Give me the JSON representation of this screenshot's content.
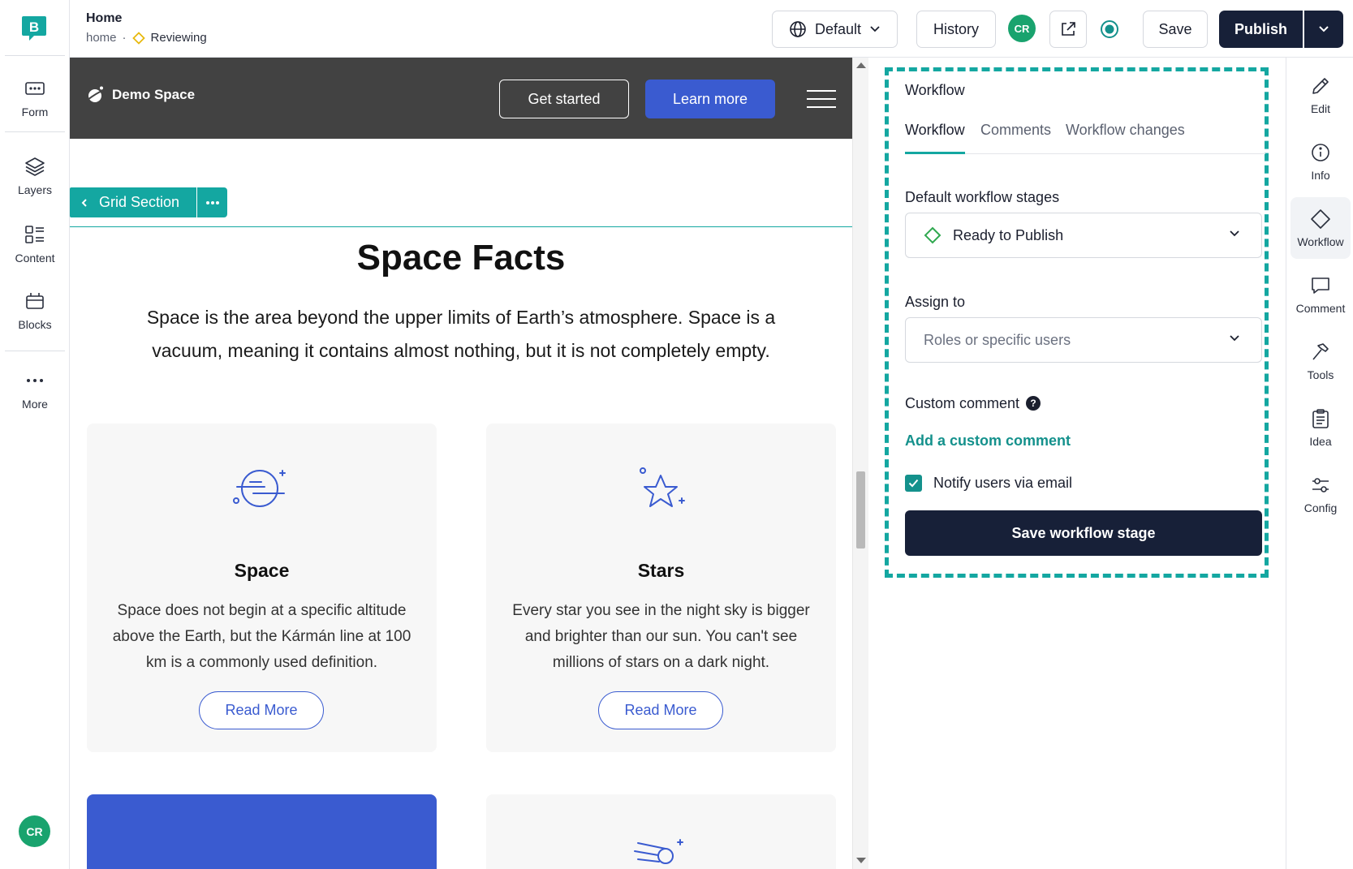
{
  "left_rail": {
    "items": [
      {
        "label": "Form",
        "icon": "form-icon"
      },
      {
        "label": "Layers",
        "icon": "layers-icon"
      },
      {
        "label": "Content",
        "icon": "content-icon"
      },
      {
        "label": "Blocks",
        "icon": "blocks-icon"
      },
      {
        "label": "More",
        "icon": "more-icon"
      }
    ],
    "user_initials": "CR"
  },
  "top_bar": {
    "page_name": "Home",
    "page_path": "home",
    "stage_separator": "·",
    "stage_label": "Reviewing",
    "locale_label": "Default",
    "history_label": "History",
    "user_initials": "CR",
    "save_label": "Save",
    "publish_label": "Publish"
  },
  "canvas": {
    "site_name": "Demo Space",
    "get_started_label": "Get started",
    "learn_more_label": "Learn more",
    "section_label": "Grid Section",
    "title": "Space Facts",
    "intro": "Space is the area beyond the upper limits of Earth’s atmosphere. Space is a vacuum, meaning it contains almost nothing, but it is not completely empty.",
    "cards": [
      {
        "title": "Space",
        "text": "Space does not begin at a specific altitude above the Earth, but the Kármán line at 100 km is a commonly used definition.",
        "button": "Read More"
      },
      {
        "title": "Stars",
        "text": "Every star you see in the night sky is bigger and brighter than our sun. You can't see millions of stars on a dark night.",
        "button": "Read More"
      }
    ]
  },
  "panel": {
    "title": "Workflow",
    "tabs": [
      "Workflow",
      "Comments",
      "Workflow changes"
    ],
    "stages_label": "Default workflow stages",
    "stage_value": "Ready to Publish",
    "assign_label": "Assign to",
    "assign_placeholder": "Roles or specific users",
    "custom_comment_label": "Custom comment",
    "help_glyph": "?",
    "add_comment_label": "Add a custom comment",
    "notify_label": "Notify users via email",
    "notify_checked": true,
    "save_stage_label": "Save workflow stage"
  },
  "right_rail": {
    "items": [
      {
        "label": "Edit",
        "icon": "pencil-icon"
      },
      {
        "label": "Info",
        "icon": "info-icon"
      },
      {
        "label": "Workflow",
        "icon": "workflow-icon"
      },
      {
        "label": "Comment",
        "icon": "comment-icon"
      },
      {
        "label": "Tools",
        "icon": "hammer-icon"
      },
      {
        "label": "Idea",
        "icon": "clipboard-icon"
      },
      {
        "label": "Config",
        "icon": "sliders-icon"
      }
    ]
  },
  "colors": {
    "accent_teal": "#14a7a1",
    "navy": "#172038",
    "site_blue": "#3a5bd0",
    "avatar_green": "#19a36e",
    "site_header_grey": "#424242"
  }
}
